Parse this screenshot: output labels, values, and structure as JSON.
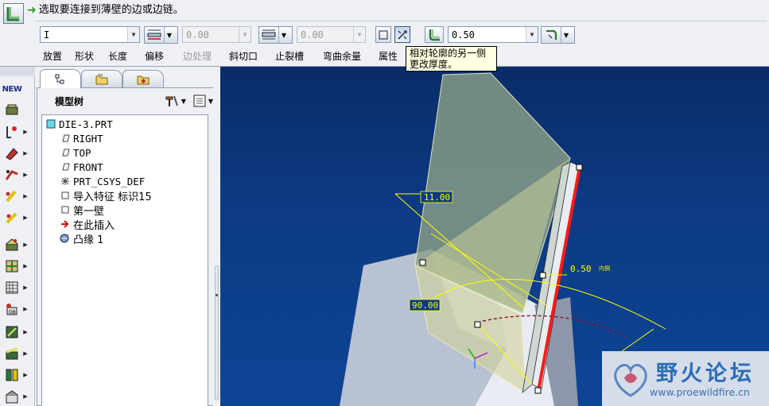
{
  "dashboard": {
    "prompt": "选取要连接到薄壁的边或边链。",
    "shape_combo": "I",
    "length_combo_1": "0.00",
    "length_combo_2": "0.00",
    "thickness_value": "0.50",
    "tabs": [
      "放置",
      "形状",
      "长度",
      "偏移",
      "边处理",
      "斜切口",
      "止裂槽",
      "弯曲余量",
      "属性"
    ],
    "tooltip_line1": "相对轮廓的另一侧",
    "tooltip_line2": "更改厚度。"
  },
  "navigator": {
    "tree_title": "模型树",
    "nodes": [
      {
        "label": "DIE-3.PRT",
        "icon": "part-icon"
      },
      {
        "label": "RIGHT",
        "icon": "datum-plane-icon"
      },
      {
        "label": "TOP",
        "icon": "datum-plane-icon"
      },
      {
        "label": "FRONT",
        "icon": "datum-plane-icon"
      },
      {
        "label": "PRT_CSYS_DEF",
        "icon": "csys-icon"
      },
      {
        "label": "导入特征 标识15",
        "icon": "feature-icon"
      },
      {
        "label": "第一壁",
        "icon": "feature-icon"
      },
      {
        "label": "在此插入",
        "icon": "insert-arrow-icon"
      },
      {
        "label": "凸缘 1",
        "icon": "flange-icon"
      }
    ]
  },
  "graphics": {
    "dim_height": "11.00",
    "dim_thickness": "0.50",
    "dim_thickness_side": "内侧",
    "dim_angle": "90.00"
  },
  "watermark": {
    "name": "野火论坛",
    "url": "www.proewildfire.cn"
  },
  "vtool": {
    "new_label": "NEW"
  },
  "colors": {
    "background_top": "#0a2c68",
    "background_bottom": "#0d4596",
    "highlight_edge": "#ff1a1a",
    "dimension": "#ffff00"
  }
}
